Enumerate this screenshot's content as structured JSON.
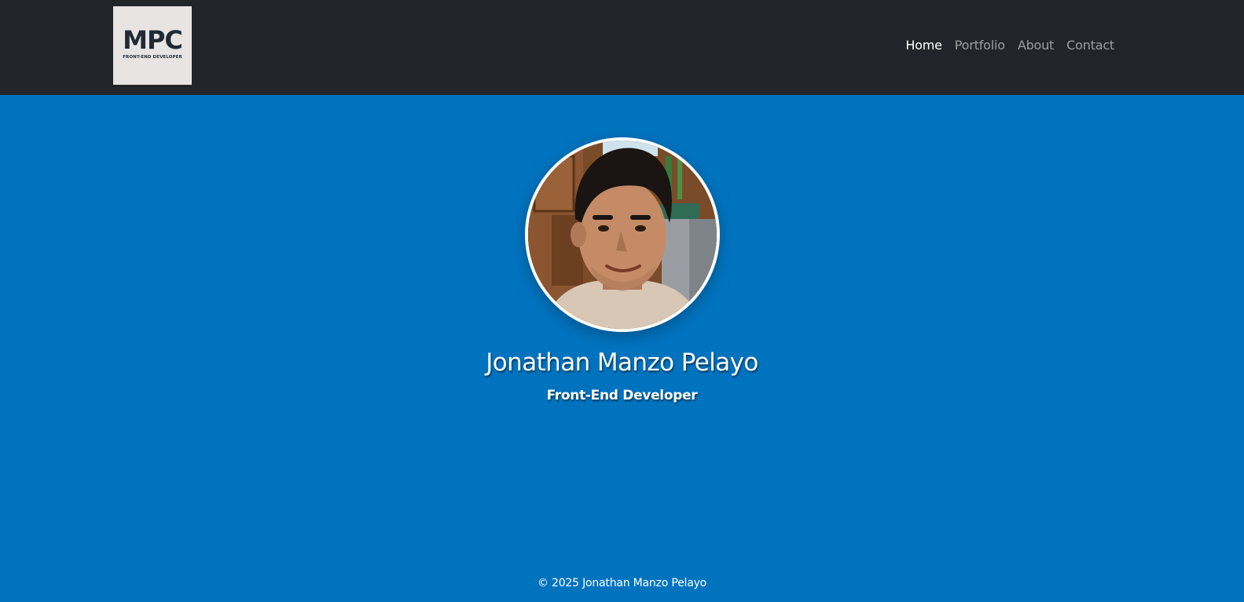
{
  "header": {
    "logo": {
      "mark": "MPC",
      "subtitle": "FRONT-END DEVELOPER"
    },
    "nav": [
      {
        "label": "Home",
        "active": true
      },
      {
        "label": "Portfolio",
        "active": false
      },
      {
        "label": "About",
        "active": false
      },
      {
        "label": "Contact",
        "active": false
      }
    ]
  },
  "hero": {
    "avatar_icon": "profile-photo",
    "name": "Jonathan Manzo Pelayo",
    "role": "Front-End Developer"
  },
  "footer": {
    "copyright": "© 2025 Jonathan Manzo Pelayo"
  },
  "colors": {
    "navbar_bg": "#212529",
    "page_bg": "#0073bf",
    "nav_active": "#ffffff",
    "nav_inactive": "rgba(255,255,255,0.55)",
    "logo_bg": "#e8e4e1",
    "logo_ink": "#1f2a36"
  }
}
